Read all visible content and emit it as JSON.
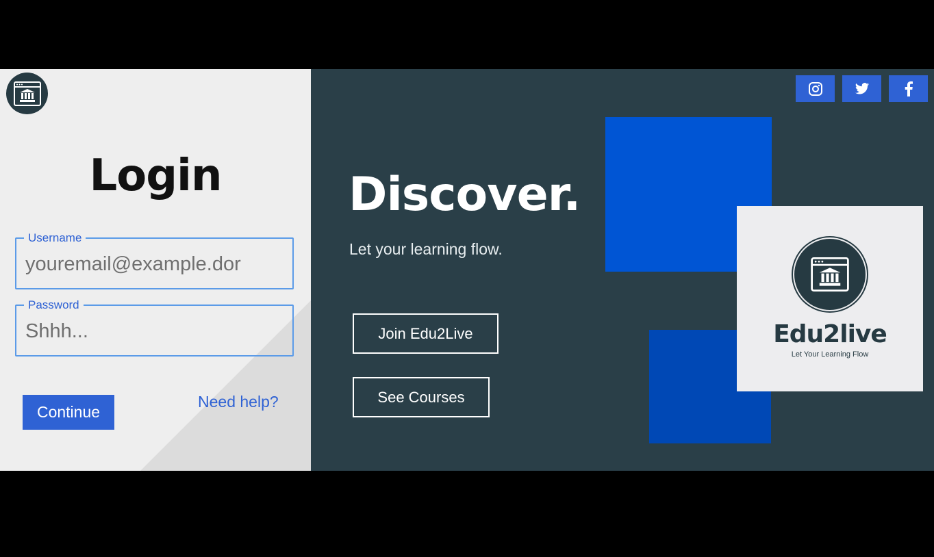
{
  "login": {
    "title": "Login",
    "username": {
      "legend": "Username",
      "placeholder": "youremail@example.dor",
      "value": ""
    },
    "password": {
      "legend": "Password",
      "placeholder": "Shhh...",
      "value": ""
    },
    "continue_label": "Continue",
    "help_label": "Need help?"
  },
  "hero": {
    "title": "Discover.",
    "tagline": "Let your learning flow.",
    "join_label": "Join Edu2Live",
    "courses_label": "See Courses"
  },
  "brand": {
    "name": "Edu2live",
    "tagline": "Let Your Learning Flow"
  },
  "social": [
    {
      "name": "instagram-icon"
    },
    {
      "name": "twitter-icon"
    },
    {
      "name": "facebook-icon"
    }
  ],
  "colors": {
    "accent_blue": "#2f62d4",
    "dark_panel": "#2a3f48",
    "bright_blue": "#0055d4",
    "light_panel": "#eeeeee"
  }
}
